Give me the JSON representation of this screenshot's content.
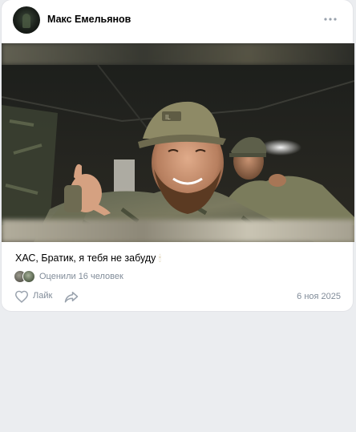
{
  "post": {
    "author": "Макс Емельянов",
    "text": "ХАС, Братик, я тебя не забуду",
    "text_emoji": "🕯",
    "likes_summary": "Оценили 16 человек",
    "like_label": "Лайк",
    "date": "6 ноя 2025"
  },
  "icons": {
    "more": "more-horizontal-icon",
    "like": "heart-outline-icon",
    "share": "share-arrow-icon"
  },
  "colors": {
    "background": "#ebedf0",
    "card": "#ffffff",
    "secondary_text": "#818c99",
    "icon": "#99a2ad"
  }
}
